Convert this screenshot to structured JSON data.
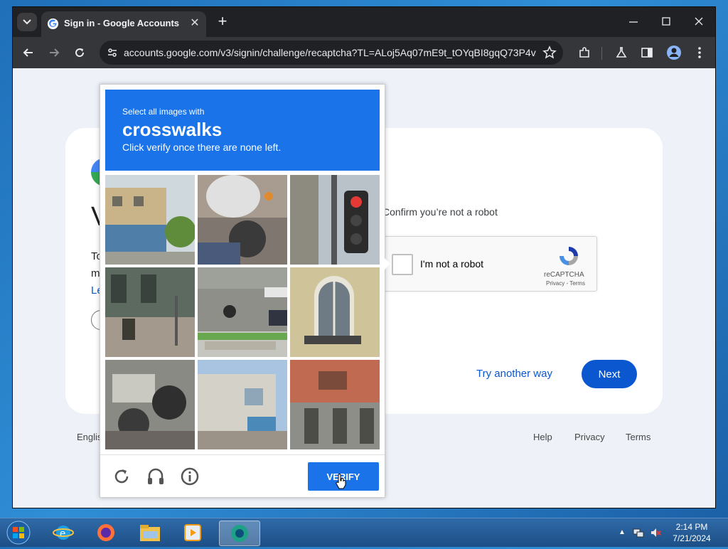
{
  "browser": {
    "tab_title": "Sign in - Google Accounts",
    "url": "accounts.google.com/v3/signin/challenge/recaptcha?TL=ALoj5Aq07mE9t_tOYqBI8gqQ73P4v...",
    "accent": "#0b57d0"
  },
  "signin": {
    "heading_fragment": "V",
    "left_fragments": [
      "To",
      "m",
      "Le"
    ],
    "confirm_text": "Confirm you’re not a robot",
    "recaptcha_label": "I'm not a robot",
    "recaptcha_brand": "reCAPTCHA",
    "recaptcha_links": "Privacy - Terms",
    "try_another": "Try another way",
    "next_label": "Next"
  },
  "footer": {
    "language": "Englis",
    "help": "Help",
    "privacy": "Privacy",
    "terms": "Terms"
  },
  "captcha": {
    "line1": "Select all images with",
    "target": "crosswalks",
    "line3": "Click verify once there are none left.",
    "verify_label": "VERIFY",
    "header_color": "#1a73e8",
    "tiles": [
      "building-with-mural",
      "person-on-motorcycle",
      "traffic-light",
      "street-cafe",
      "motorcyclist-on-road",
      "arched-window",
      "motorcycles-pile",
      "small-building",
      "brick-building"
    ]
  },
  "taskbar": {
    "time": "2:14 PM",
    "date": "7/21/2024",
    "apps": [
      "internet-explorer",
      "firefox",
      "file-explorer",
      "media-player",
      "active-app"
    ]
  }
}
